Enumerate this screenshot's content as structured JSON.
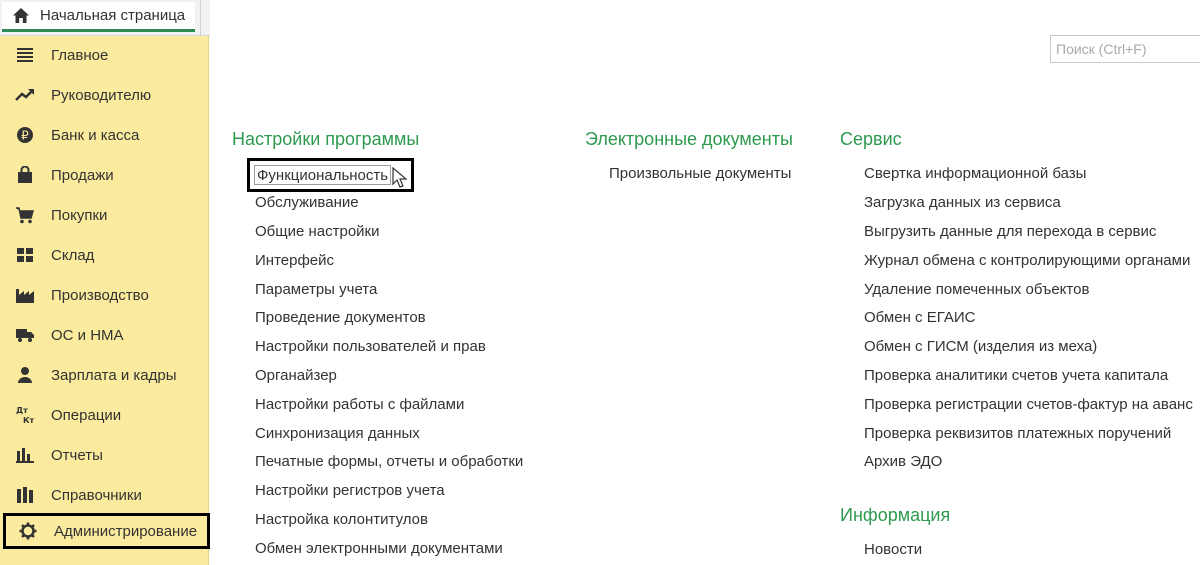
{
  "tab": {
    "home_label": "Начальная страница"
  },
  "sidebar": {
    "items": [
      {
        "label": "Главное",
        "icon": "menu-lines-icon"
      },
      {
        "label": "Руководителю",
        "icon": "trend-up-icon"
      },
      {
        "label": "Банк и касса",
        "icon": "ruble-coin-icon"
      },
      {
        "label": "Продажи",
        "icon": "shopping-bag-icon"
      },
      {
        "label": "Покупки",
        "icon": "cart-icon"
      },
      {
        "label": "Склад",
        "icon": "warehouse-grid-icon"
      },
      {
        "label": "Производство",
        "icon": "factory-icon"
      },
      {
        "label": "ОС и НМА",
        "icon": "truck-icon"
      },
      {
        "label": "Зарплата и кадры",
        "icon": "person-icon"
      },
      {
        "label": "Операции",
        "icon": "debit-credit-icon",
        "icon_text_top": "Дт",
        "icon_text_bottom": "Кт"
      },
      {
        "label": "Отчеты",
        "icon": "bar-chart-icon"
      },
      {
        "label": "Справочники",
        "icon": "books-icon"
      },
      {
        "label": "Администрирование",
        "icon": "gear-icon",
        "selected": true
      }
    ]
  },
  "search": {
    "placeholder": "Поиск (Ctrl+F)"
  },
  "sections": {
    "settings": {
      "title": "Настройки программы",
      "items": [
        "Функциональность",
        "Обслуживание",
        "Общие настройки",
        "Интерфейс",
        "Параметры учета",
        "Проведение документов",
        "Настройки пользователей и прав",
        "Органайзер",
        "Настройки работы с файлами",
        "Синхронизация данных",
        "Печатные формы, отчеты и обработки",
        "Настройки регистров учета",
        "Настройка колонтитулов",
        "Обмен электронными документами"
      ]
    },
    "edocs": {
      "title": "Электронные документы",
      "items": [
        "Произвольные документы"
      ]
    },
    "service": {
      "title": "Сервис",
      "items": [
        "Свертка информационной базы",
        "Загрузка данных из сервиса",
        "Выгрузить данные для перехода в сервис",
        "Журнал обмена с контролирующими органами",
        "Удаление помеченных объектов",
        "Обмен с ЕГАИС",
        "Обмен с ГИСМ (изделия из меха)",
        "Проверка аналитики счетов учета капитала",
        "Проверка регистрации счетов-фактур на аванс",
        "Проверка реквизитов платежных поручений",
        "Архив ЭДО"
      ]
    },
    "info": {
      "title": "Информация",
      "items": [
        "Новости"
      ]
    }
  },
  "colors": {
    "sidebar_bg": "#fbeb9e",
    "section_title": "#2e9a4f",
    "tab_accent": "#2e8b57"
  }
}
